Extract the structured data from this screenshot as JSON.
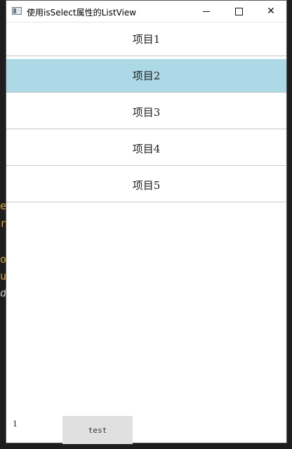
{
  "window": {
    "title": "使用isSelect属性的ListView",
    "controls": {
      "minimize_icon": "minimize-icon",
      "maximize_icon": "maximize-icon",
      "close_icon": "close-icon",
      "close_glyph": "✕"
    }
  },
  "background_editor": {
    "glyphs": [
      "e",
      "r",
      "o",
      "u",
      "d"
    ]
  },
  "list": {
    "items": [
      {
        "label": "项目1",
        "selected": false
      },
      {
        "label": "项目2",
        "selected": true
      },
      {
        "label": "项目3",
        "selected": false
      },
      {
        "label": "项目4",
        "selected": false
      },
      {
        "label": "项目5",
        "selected": false
      }
    ],
    "selected_color": "#add8e6"
  },
  "footer": {
    "counter": "1",
    "button_label": "test"
  }
}
